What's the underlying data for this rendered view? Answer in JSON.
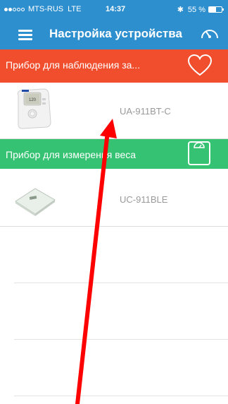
{
  "status_bar": {
    "carrier": "MTS-RUS",
    "network": "LTE",
    "time": "14:37",
    "battery_text": "55 %",
    "battery_level": 0.55,
    "signal_dots": 2
  },
  "nav": {
    "title": "Настройка устройства",
    "menu_icon": "hamburger-menu-icon",
    "right_icon": "gauge-icon"
  },
  "sections": [
    {
      "header": "Прибор для наблюдения за...",
      "icon": "heart-icon",
      "color": "#f04e2d",
      "devices": [
        {
          "model": "UA-911BT-C",
          "image": "blood-pressure-monitor"
        }
      ]
    },
    {
      "header": "Прибор для измерения веса",
      "icon": "scale-icon",
      "color": "#35c272",
      "devices": [
        {
          "model": "UC-911BLE",
          "image": "glass-bathroom-scale"
        }
      ]
    }
  ],
  "colors": {
    "nav_bar": "#2e8fcf",
    "annotation_arrow": "#ff0000"
  }
}
